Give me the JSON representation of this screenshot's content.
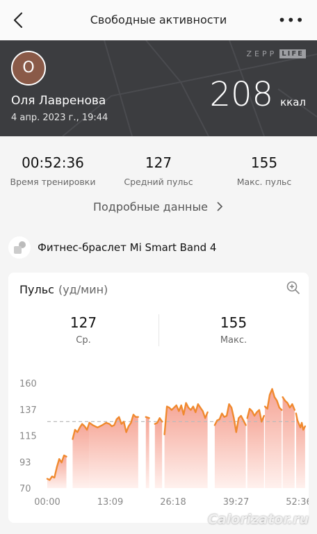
{
  "header": {
    "title": "Свободные активности"
  },
  "hero": {
    "avatar_initial": "О",
    "user_name": "Оля Лавренова",
    "date": "4 апр. 2023 г., 19:44",
    "calories": "208",
    "calories_unit": "ккал",
    "logo_zepp": "ZEPP",
    "logo_life": "LIFE"
  },
  "stats": [
    {
      "value": "00:52:36",
      "label": "Время тренировки"
    },
    {
      "value": "127",
      "label": "Средний пульс"
    },
    {
      "value": "155",
      "label": "Макс. пульс"
    }
  ],
  "details_link": "Подробные данные",
  "device": {
    "label": "Фитнес-браслет Mi Smart Band 4"
  },
  "heart_card": {
    "title": "Пульс",
    "unit": "(уд/мин)",
    "avg_value": "127",
    "avg_label": "Ср.",
    "max_value": "155",
    "max_label": "Макс."
  },
  "chart_data": {
    "type": "area",
    "y_ticks": [
      "160",
      "137",
      "115",
      "93",
      "70"
    ],
    "x_ticks": [
      "00:00",
      "13:09",
      "26:18",
      "39:27",
      "52:36"
    ],
    "ylim": [
      70,
      160
    ],
    "xlim": [
      0,
      52.6
    ],
    "average_line": 127,
    "colors": {
      "line": "#f0892e",
      "fill_top": "#f5a596",
      "fill_bottom": "#fff1ee",
      "avg": "#bbbbbb"
    },
    "segments": [
      {
        "x": [
          0,
          0.5,
          1,
          1.5,
          2,
          2.5,
          3,
          3.5,
          4
        ],
        "y": [
          78,
          77,
          80,
          79,
          88,
          95,
          92,
          98,
          97
        ]
      },
      {
        "x": [
          5.3,
          5.8,
          6.3,
          6.8,
          7.3,
          7.8,
          8.3,
          8.8
        ],
        "y": [
          112,
          120,
          118,
          122,
          125,
          123,
          120,
          126
        ]
      },
      {
        "x": [
          8.8,
          9.5,
          10.5,
          11.5,
          12.3,
          13,
          13.5,
          14,
          14.5,
          15,
          15.5,
          16,
          16.5,
          17,
          17.5,
          18,
          18.5,
          19
        ],
        "y": [
          126,
          124,
          122,
          124,
          126,
          125,
          123,
          124,
          129,
          131,
          125,
          127,
          118,
          123,
          126,
          133,
          131,
          131
        ]
      },
      {
        "x": [
          20.6,
          21.3
        ],
        "y": [
          131,
          130
        ]
      },
      {
        "x": [
          22.5,
          23,
          23.5,
          24
        ],
        "y": [
          125,
          126,
          130,
          127
        ]
      },
      {
        "x": [
          24.5,
          25,
          25.5,
          26,
          26.5,
          27,
          27.5,
          28,
          28.5,
          29,
          29.5,
          30,
          30.5,
          31,
          31.5,
          32,
          32.5,
          33,
          33.5
        ],
        "y": [
          116,
          140,
          139,
          137,
          139,
          141,
          136,
          141,
          133,
          143,
          139,
          137,
          140,
          135,
          142,
          139,
          136,
          130,
          135
        ]
      },
      {
        "x": [
          35,
          35.5,
          36,
          36.5,
          37,
          37.5,
          38,
          38.5,
          39,
          39.5,
          40,
          40.5,
          41,
          41.5
        ],
        "y": [
          124,
          128,
          129,
          134,
          131,
          132,
          142,
          139,
          130,
          118,
          130,
          132,
          128,
          124
        ]
      },
      {
        "x": [
          41.8,
          42.3,
          42.8,
          43.3,
          43.8,
          44.3,
          44.8,
          45.3
        ],
        "y": [
          130,
          138,
          136,
          132,
          135,
          137,
          127,
          132
        ]
      },
      {
        "x": [
          45.5,
          46,
          46.5,
          47,
          47.5,
          48,
          48.5,
          49
        ],
        "y": [
          140,
          138,
          150,
          155,
          148,
          145,
          139,
          137
        ]
      },
      {
        "x": [
          49.2,
          49.7,
          50.2,
          50.7,
          51.2,
          51.7
        ],
        "y": [
          148,
          145,
          143,
          139,
          142,
          137
        ]
      },
      {
        "x": [
          52,
          52.3,
          52.6,
          52.9,
          53.2,
          53.5,
          53.9
        ],
        "y": [
          134,
          128,
          125,
          122,
          126,
          120,
          123
        ]
      }
    ]
  },
  "watermark": "Calorizator.ru"
}
